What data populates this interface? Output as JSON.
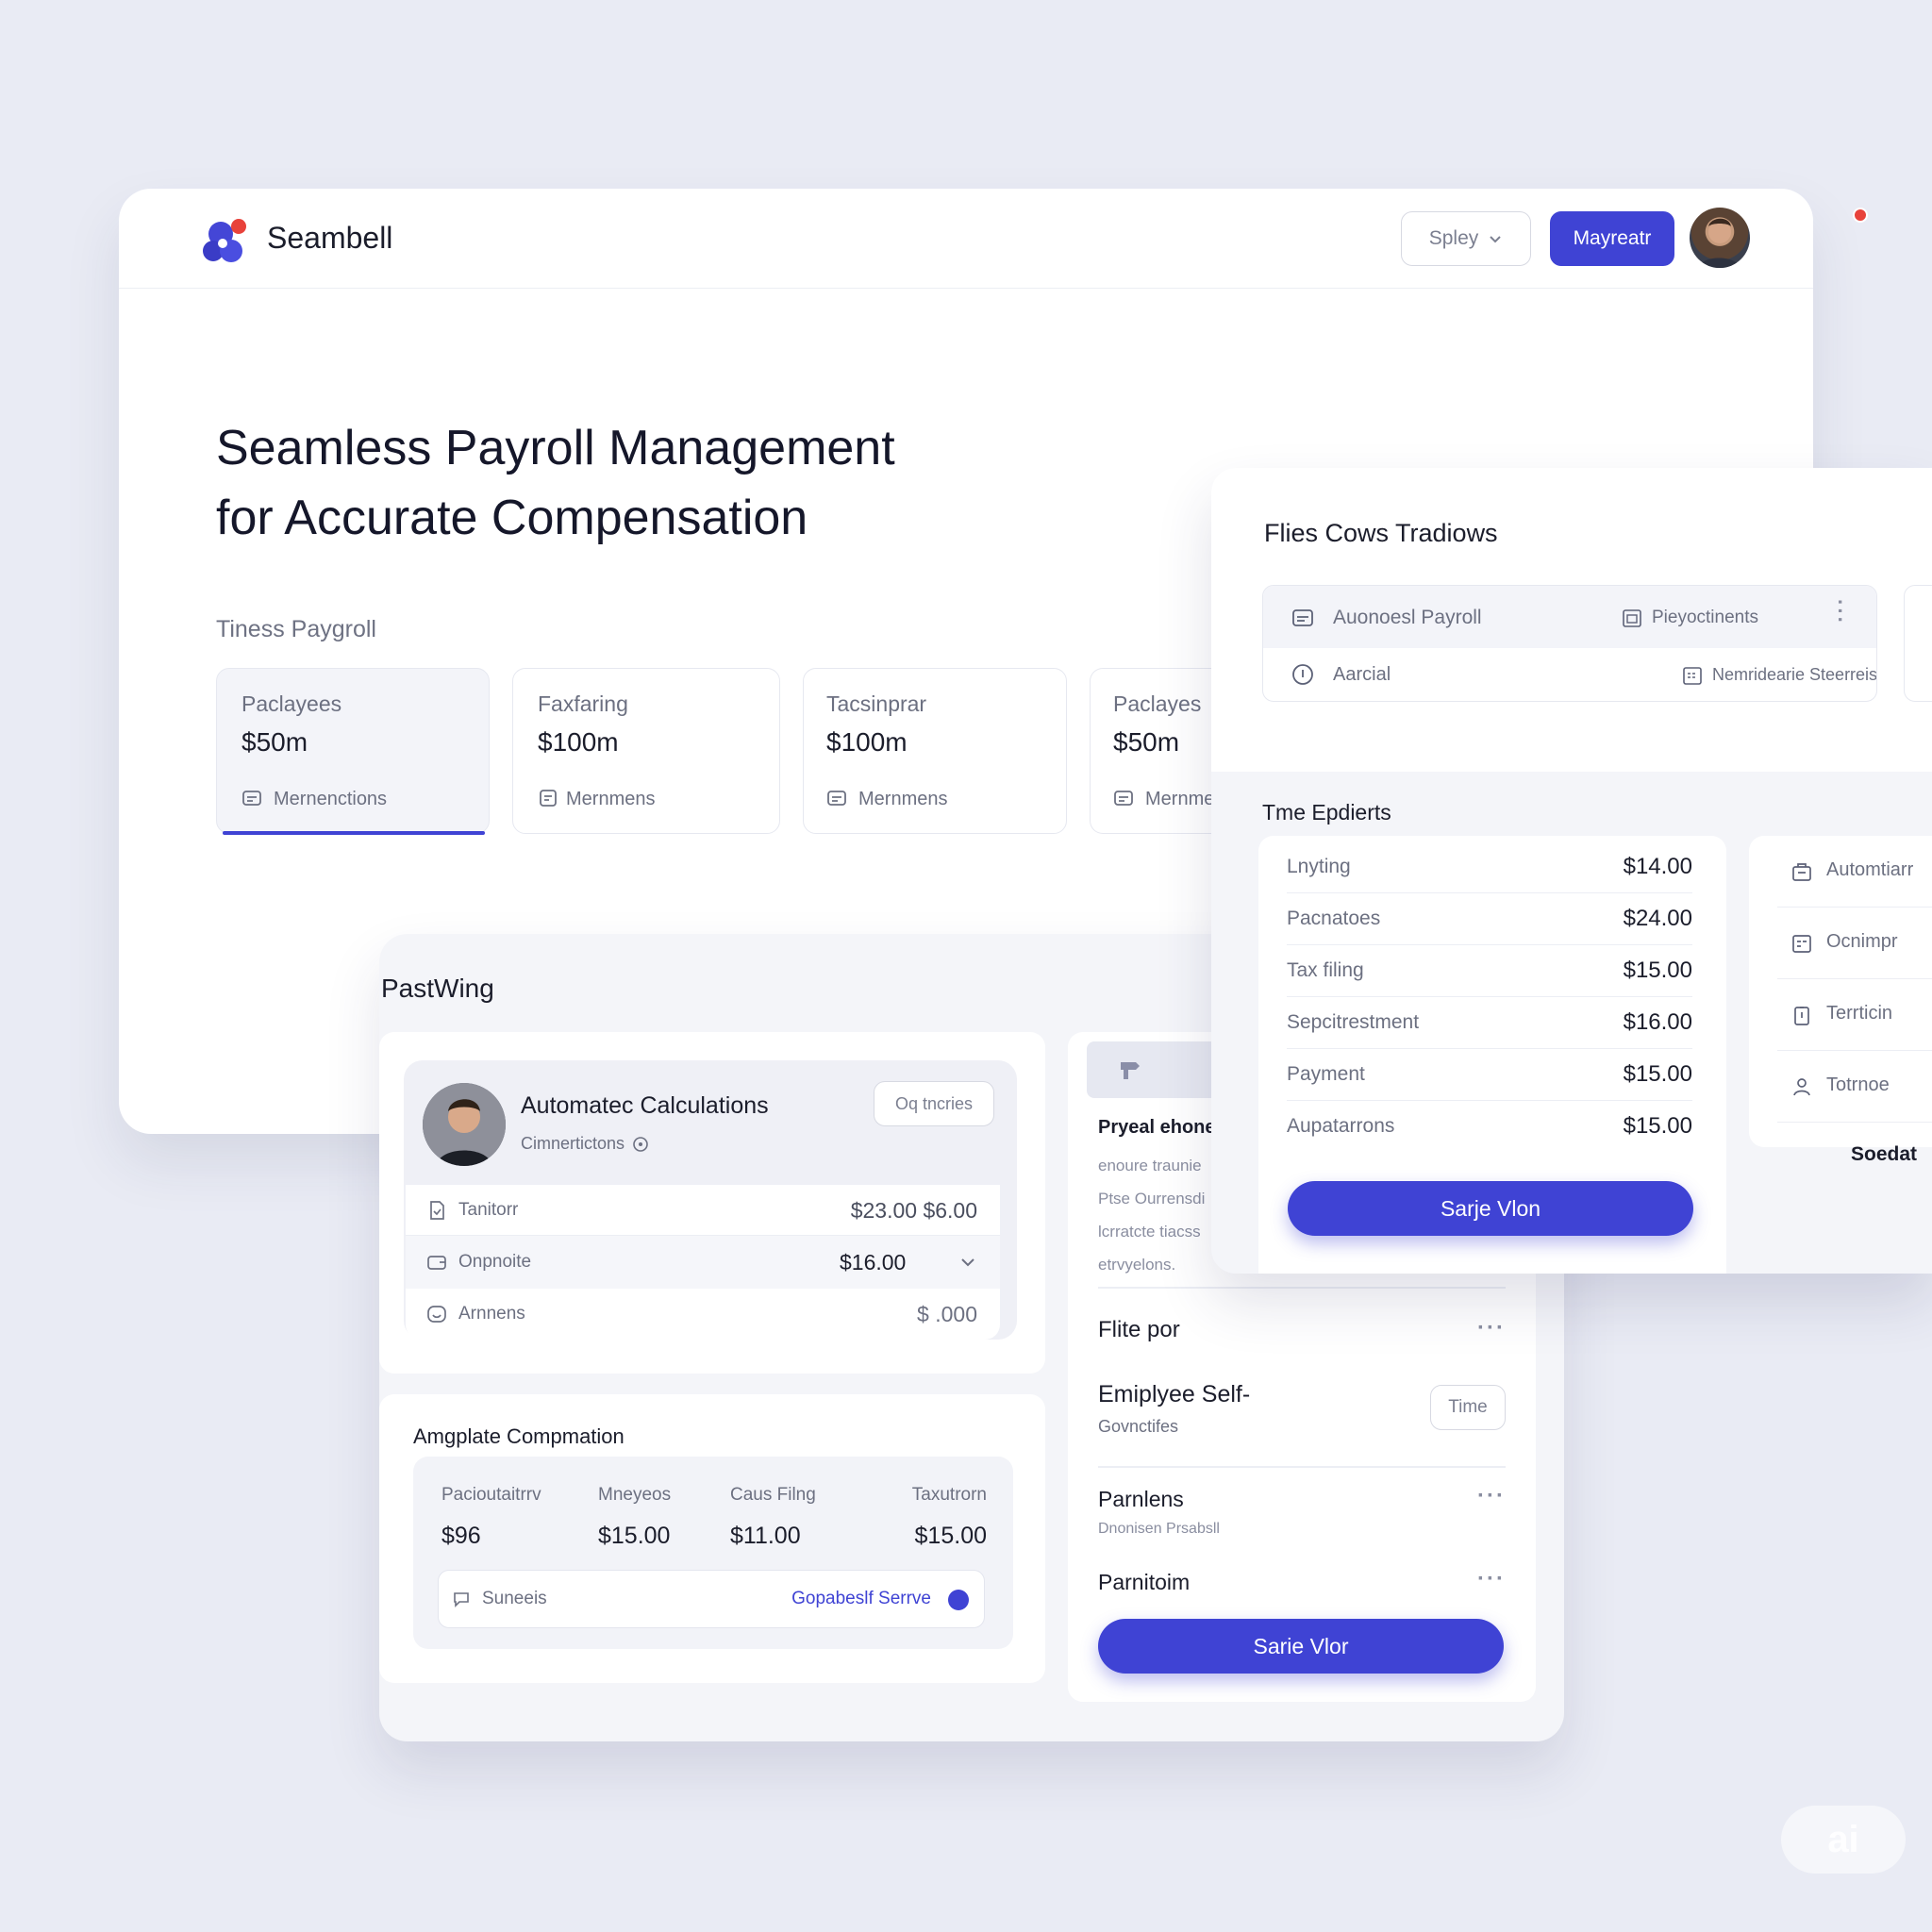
{
  "header": {
    "brand": "Seambell",
    "dropdown_label": "Spley",
    "primary_label": "Mayreatr"
  },
  "hero": {
    "title_line1": "Seamless Payroll Management",
    "title_line2": "for Accurate Compensation",
    "section_label": "Tiness Paygroll"
  },
  "stat_cards": [
    {
      "label": "Paclayees",
      "value": "$50m",
      "footer": "Mernenctions"
    },
    {
      "label": "Faxfaring",
      "value": "$100m",
      "footer": "Mernmens"
    },
    {
      "label": "Tacsinprar",
      "value": "$100m",
      "footer": "Mernmens"
    },
    {
      "label": "Paclayes",
      "value": "$50m",
      "footer": "Mernme"
    }
  ],
  "right_panel": {
    "title": "Flies Cows Tradiows",
    "list": [
      {
        "left": "Auonoesl Payroll",
        "right": "Pieyoctinents"
      },
      {
        "left": "Aarcial",
        "right": "Nemridearie Steerreis"
      }
    ],
    "section_title": "Tme Epdierts",
    "rows": [
      {
        "label": "Lnyting",
        "value": "$14.00"
      },
      {
        "label": "Pacnatoes",
        "value": "$24.00"
      },
      {
        "label": "Tax filing",
        "value": "$15.00"
      },
      {
        "label": "Sepcitrestment",
        "value": "$16.00"
      },
      {
        "label": "Payment",
        "value": "$15.00"
      },
      {
        "label": "Aupatarrons",
        "value": "$15.00"
      }
    ],
    "button": "Sarje Vlon",
    "side_items": [
      "Automtiarr",
      "Ocnimpr",
      "Terrticin",
      "Totrnoe"
    ],
    "side_caption": "Soedat"
  },
  "middle": {
    "section_title": "PastWing",
    "profile": {
      "name": "Automatec Calculations",
      "sub": "Cimnertictons",
      "pill": "Oq tncries"
    },
    "rows": [
      {
        "label": "Tanitorr",
        "value": "$23.00 $6.00"
      },
      {
        "label": "Onpnoite",
        "value": "$16.00"
      },
      {
        "label": "Arnnens",
        "value": "$\u0002\u0000 .000"
      }
    ],
    "comp": {
      "title": "Amgplate Compmation",
      "cols": [
        {
          "label": "Pacioutaitrrv",
          "value": "$96"
        },
        {
          "label": "Mneyeos",
          "value": "$15.00"
        },
        {
          "label": "Caus Filng",
          "value": "$11.00"
        },
        {
          "label": "Taxutrorn",
          "value": "$15.00"
        }
      ],
      "footer_left": "Suneeis",
      "footer_right": "Gopabeslf Serrve"
    }
  },
  "side_card": {
    "heading": "Pryeal ehone",
    "lines": [
      "enoure traunie",
      "Ptse Ourrensdi",
      "lcrratcte tiacss",
      "etrvyelons."
    ],
    "items": [
      {
        "title": "Flite por",
        "sub": ""
      },
      {
        "title": "Emiplyee Self-",
        "sub": "Govnctifes",
        "pill": "Time"
      },
      {
        "title": "Parnlens",
        "sub": "Dnonisen Prsabsll"
      },
      {
        "title": "Parnitoim",
        "sub": ""
      }
    ],
    "button": "Sarie Vlor"
  },
  "watermark": "ai",
  "colors": {
    "accent": "#3f43d4",
    "background": "#e9ebf4",
    "notification": "#e8423b"
  }
}
